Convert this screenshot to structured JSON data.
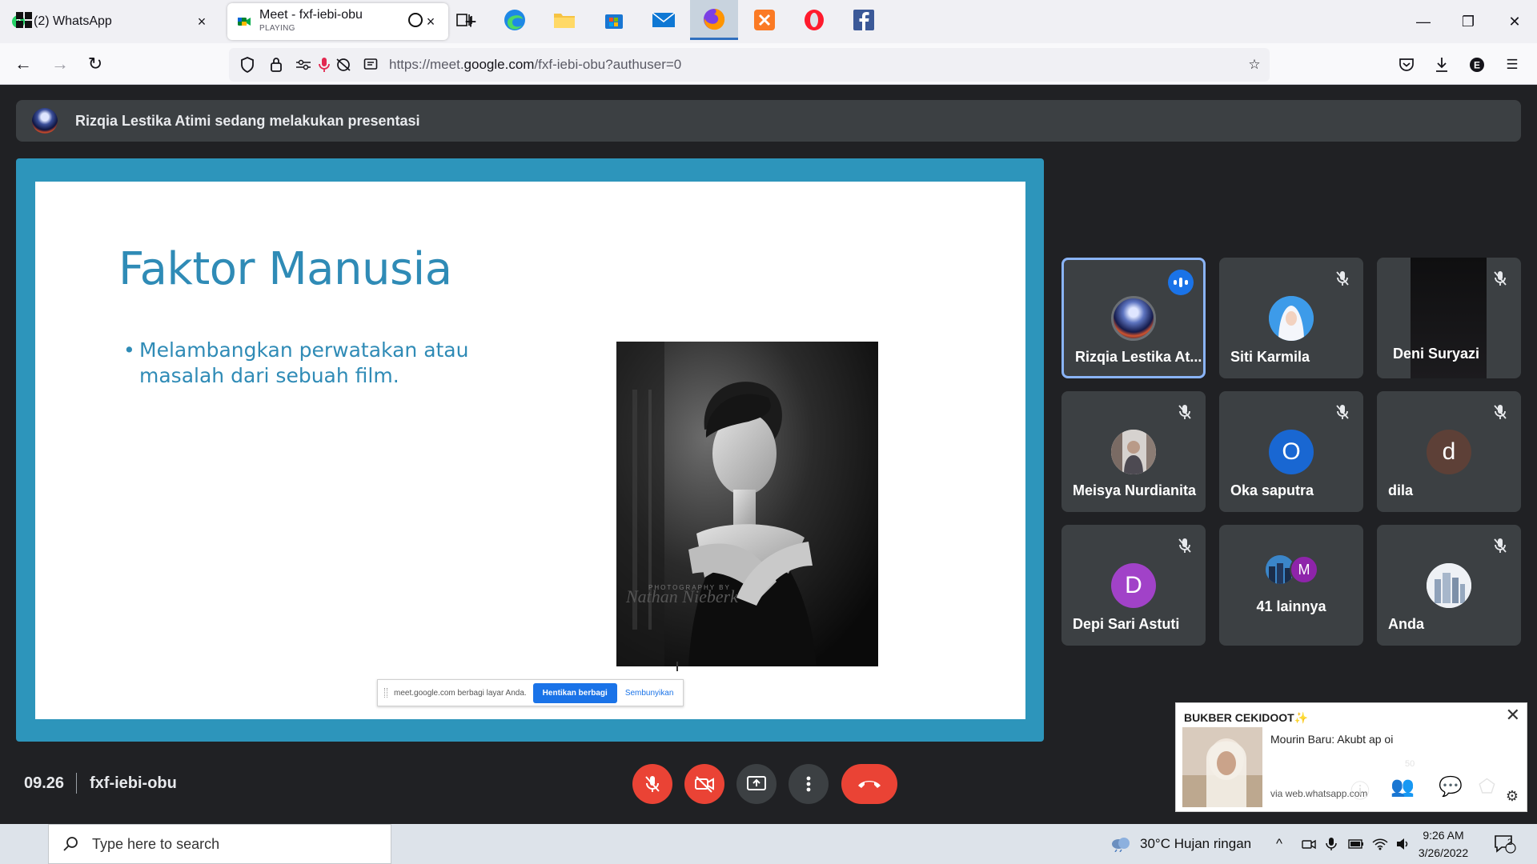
{
  "browser": {
    "tabs": [
      {
        "title": "(2) WhatsApp",
        "subtitle": "",
        "active": false
      },
      {
        "title": "Meet - fxf-iebi-obu",
        "subtitle": "PLAYING",
        "active": true
      }
    ],
    "new_tab": "+",
    "url_prefix": "https://meet.",
    "url_domain": "google.com",
    "url_path": "/fxf-iebi-obu?authuser=0"
  },
  "meet": {
    "presenting_text": "Rizqia Lestika Atimi sedang melakukan presentasi",
    "slide": {
      "title": "Faktor Manusia",
      "bullet_mark": "•",
      "bullet": "Melambangkan perwatakan atau masalah dari sebuah film."
    },
    "share_bar": {
      "message": "meet.google.com berbagi layar Anda.",
      "stop_label": "Hentikan berbagi",
      "hide_label": "Sembunyikan"
    },
    "participants": [
      {
        "name": "Rizqia Lestika At...",
        "avatar_type": "photo",
        "speaking": true
      },
      {
        "name": "Siti Karmila",
        "avatar_type": "photo",
        "muted": true
      },
      {
        "name": "Deni Suryazi",
        "avatar_type": "video",
        "muted": true
      },
      {
        "name": "Meisya Nurdianita",
        "avatar_type": "photo",
        "muted": true
      },
      {
        "name": "Oka saputra",
        "initial": "O",
        "color": "#1967d2",
        "muted": true
      },
      {
        "name": "dila",
        "initial": "d",
        "color": "#5d4037",
        "muted": true
      },
      {
        "name": "Depi Sari Astuti",
        "initial": "D",
        "color": "#a142c8",
        "muted": true
      },
      {
        "name": "41 lainnya",
        "initial": "M",
        "color": "#8e24aa"
      },
      {
        "name": "Anda",
        "avatar_type": "photo",
        "muted": true
      }
    ],
    "time": "09.26",
    "meeting_code": "fxf-iebi-obu"
  },
  "notification": {
    "title": "BUKBER CEKIDOOT",
    "title_emoji": "✨",
    "message": "Mourin Baru: Akubt ap oi",
    "via": "via web.whatsapp.com",
    "ghost_badge": "50"
  },
  "taskbar": {
    "search_placeholder": "Type here to search",
    "weather": "30°C  Hujan ringan",
    "time": "9:26 AM",
    "date": "3/26/2022",
    "notification_count": "2"
  },
  "colors": {
    "meet_bg": "#202124",
    "tile_bg": "#3c4043",
    "stage_border": "#2d95bb",
    "slide_text": "#2f8bb6",
    "danger": "#ea4335",
    "accent": "#1a73e8"
  }
}
